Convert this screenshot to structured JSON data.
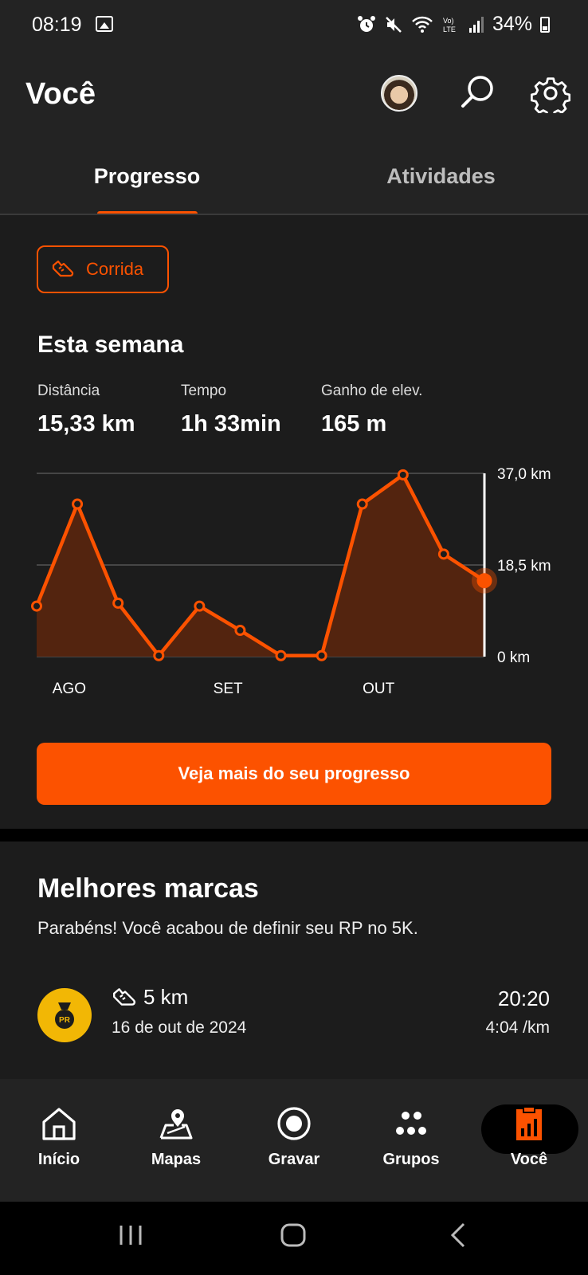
{
  "status_bar": {
    "time": "08:19",
    "battery": "34%",
    "icons": [
      "image-icon",
      "alarm-icon",
      "mute-icon",
      "wifi-icon",
      "volte-icon",
      "signal-icon",
      "battery-icon"
    ]
  },
  "header": {
    "title": "Você",
    "tabs": [
      {
        "label": "Progresso",
        "active": true
      },
      {
        "label": "Atividades",
        "active": false
      }
    ]
  },
  "progress": {
    "sport_filter": "Corrida",
    "section_title": "Esta semana",
    "stats": [
      {
        "label": "Distância",
        "value": "15,33 km"
      },
      {
        "label": "Tempo",
        "value": "1h 33min"
      },
      {
        "label": "Ganho de elev.",
        "value": "165 m"
      }
    ],
    "cta_label": "Veja mais do seu progresso"
  },
  "chart_data": {
    "type": "area",
    "title": "",
    "xlabel": "",
    "ylabel": "",
    "x_tick_labels": [
      "AGO",
      "SET",
      "OUT"
    ],
    "y_tick_labels": [
      "37,0 km",
      "18,5 km",
      "0 km"
    ],
    "ylim": [
      0,
      37.0
    ],
    "grid": true,
    "series": [
      {
        "values": [
          10.2,
          30.8,
          10.8,
          0.2,
          10.2,
          5.3,
          0.2,
          0.2,
          30.8,
          36.7,
          20.7,
          15.33
        ]
      }
    ],
    "color": "#fc5200"
  },
  "records": {
    "title": "Melhores marcas",
    "subtitle": "Parabéns! Você acabou de definir seu RP no 5K.",
    "item": {
      "badge": "PR",
      "distance": "5 km",
      "date": "16 de out de 2024",
      "time": "20:20",
      "pace": "4:04 /km"
    }
  },
  "tabbar": {
    "items": [
      {
        "label": "Início",
        "icon": "home-icon"
      },
      {
        "label": "Mapas",
        "icon": "map-icon"
      },
      {
        "label": "Gravar",
        "icon": "record-icon"
      },
      {
        "label": "Grupos",
        "icon": "groups-icon"
      },
      {
        "label": "Você",
        "icon": "you-icon",
        "active": true
      }
    ]
  },
  "colors": {
    "accent": "#fc5200",
    "background": "#1c1c1c",
    "pr_badge": "#f2b705"
  }
}
